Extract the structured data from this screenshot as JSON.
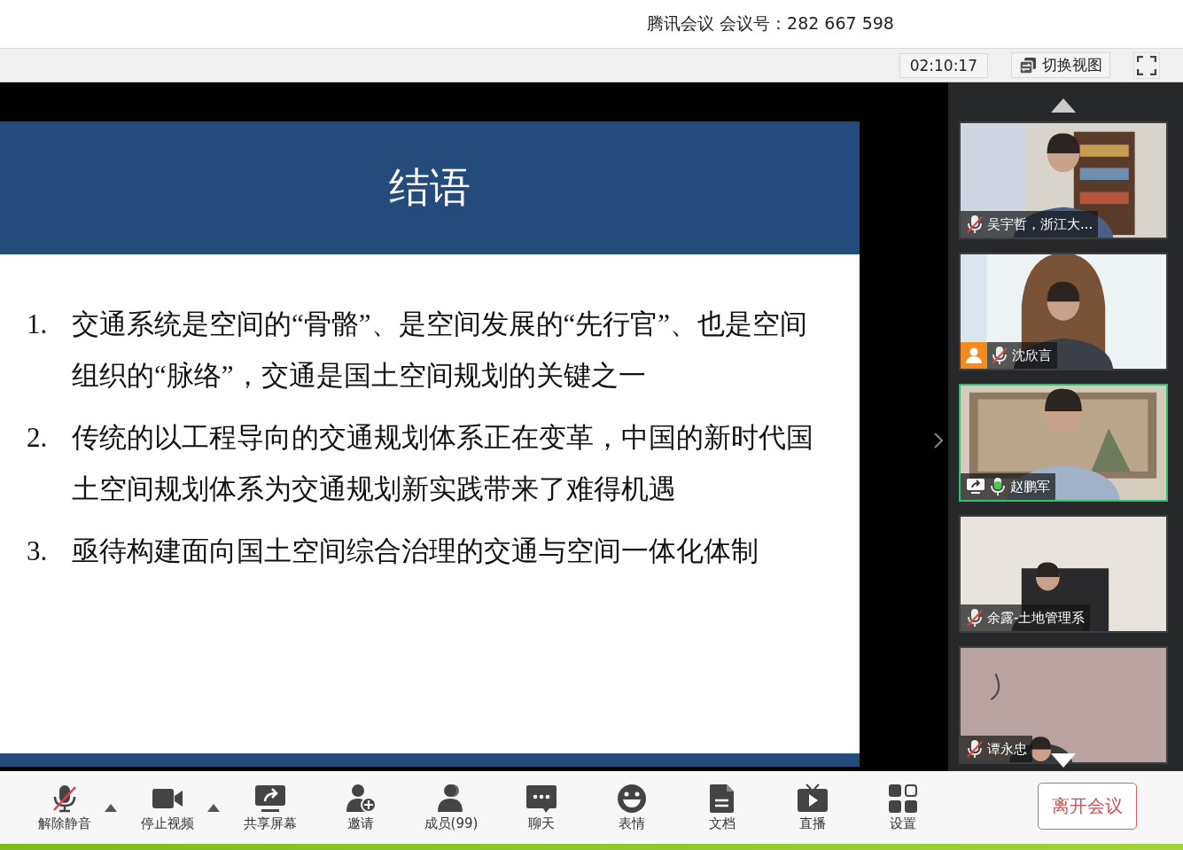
{
  "title_bar": {
    "title": "腾讯会议 会议号：282 667 598"
  },
  "sub_bar": {
    "timer": "02:10:17",
    "switch_view": "切换视图"
  },
  "slide": {
    "title": "结语",
    "items": [
      {
        "number": "1.",
        "text": "交通系统是空间的“骨骼”、是空间发展的“先行官”、也是空间组织的“脉络”，交通是国土空间规划的关键之一"
      },
      {
        "number": "2.",
        "text": "传统的以工程导向的交通规划体系正在变革，中国的新时代国土空间规划体系为交通规划新实践带来了难得机遇"
      },
      {
        "number": "3.",
        "text": "亟待构建面向国土空间综合治理的交通与空间一体化体制"
      }
    ]
  },
  "participants": [
    {
      "name": "吴宇哲，浙江大...",
      "muted": true,
      "avatar_badge": false,
      "sharing": false,
      "selected": false
    },
    {
      "name": "沈欣言",
      "muted": true,
      "avatar_badge": true,
      "sharing": false,
      "selected": false
    },
    {
      "name": "赵鹏军",
      "muted": false,
      "avatar_badge": false,
      "sharing": true,
      "selected": true
    },
    {
      "name": "余露-土地管理系",
      "muted": true,
      "avatar_badge": false,
      "sharing": false,
      "selected": false
    },
    {
      "name": "谭永忠",
      "muted": true,
      "avatar_badge": false,
      "sharing": false,
      "selected": false
    }
  ],
  "toolbar": [
    {
      "kind": "mic-muted",
      "label": "解除静音",
      "has_menu": true
    },
    {
      "kind": "video",
      "label": "停止视频",
      "has_menu": true
    },
    {
      "kind": "share",
      "label": "共享屏幕",
      "has_menu": false
    },
    {
      "kind": "invite",
      "label": "邀请",
      "has_menu": false
    },
    {
      "kind": "members",
      "label": "成员(99)",
      "has_menu": false
    },
    {
      "kind": "chat",
      "label": "聊天",
      "has_menu": false
    },
    {
      "kind": "emoji",
      "label": "表情",
      "has_menu": false
    },
    {
      "kind": "doc",
      "label": "文档",
      "has_menu": false
    },
    {
      "kind": "live",
      "label": "直播",
      "has_menu": false
    },
    {
      "kind": "settings",
      "label": "设置",
      "has_menu": false
    }
  ],
  "leave_button": "离开会议"
}
